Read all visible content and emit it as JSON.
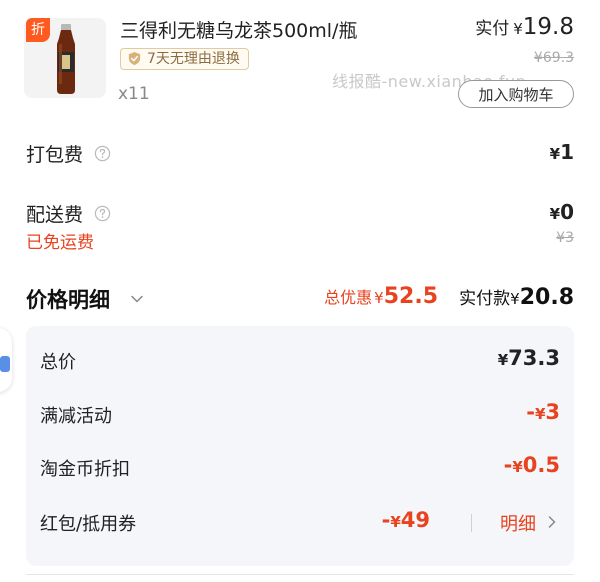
{
  "product": {
    "discount_tag": "折",
    "title": "三得利无糖乌龙茶500ml/瓶",
    "return_policy": "7天无理由退换",
    "quantity": "x11",
    "actual_label": "实付",
    "currency": "¥",
    "actual_price": "19.8",
    "original_price": "¥69.3",
    "add_to_cart_label": "加入购物车"
  },
  "watermark": "线报酷-new.xianbao.fun",
  "fees": {
    "packing": {
      "label": "打包费",
      "currency": "¥",
      "value": "1"
    },
    "delivery": {
      "label": "配送费",
      "currency": "¥",
      "value": "0",
      "free_text": "已免运费",
      "original": "¥3"
    }
  },
  "detail": {
    "title": "价格明细",
    "total_discount_label": "总优惠",
    "currency": "¥",
    "total_discount_value": "52.5",
    "total_pay_label": "实付款",
    "total_pay_value": "20.8"
  },
  "breakdown": [
    {
      "label": "总价",
      "currency": "¥",
      "value": "73.3"
    },
    {
      "label": "满减活动",
      "sign": "-",
      "currency": "¥",
      "value": "3"
    },
    {
      "label": "淘金币折扣",
      "sign": "-",
      "currency": "¥",
      "value": "0.5"
    },
    {
      "label": "红包/抵用券",
      "sign": "-",
      "currency": "¥",
      "value": "49",
      "link_label": "明细"
    }
  ],
  "colors": {
    "accent_red": "#e8421e",
    "discount_tag_bg": "#ff5a1f",
    "card_bg": "#f4f6f9",
    "side_tab_accent": "#5a8fe8"
  }
}
